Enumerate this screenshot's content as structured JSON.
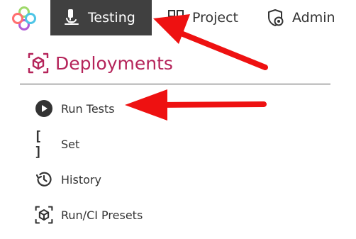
{
  "nav": {
    "items": [
      {
        "label": "Testing",
        "icon": "microscope-icon",
        "active": true
      },
      {
        "label": "Project",
        "icon": "grid-icon"
      },
      {
        "label": "Admin",
        "icon": "shield-gear-icon"
      }
    ]
  },
  "section": {
    "title": "Deployments",
    "icon": "deployment-cube-icon"
  },
  "menu": {
    "items": [
      {
        "label": "Run Tests",
        "icon": "play-circle-icon"
      },
      {
        "label": "Set",
        "icon": "brackets-icon",
        "glyph": "[ ]"
      },
      {
        "label": "History",
        "icon": "history-icon"
      },
      {
        "label": "Run/CI Presets",
        "icon": "preset-cube-icon"
      }
    ]
  },
  "colors": {
    "accent": "#b5245a",
    "active_nav_bg": "#404040",
    "annotation_arrow": "#ee1111"
  }
}
